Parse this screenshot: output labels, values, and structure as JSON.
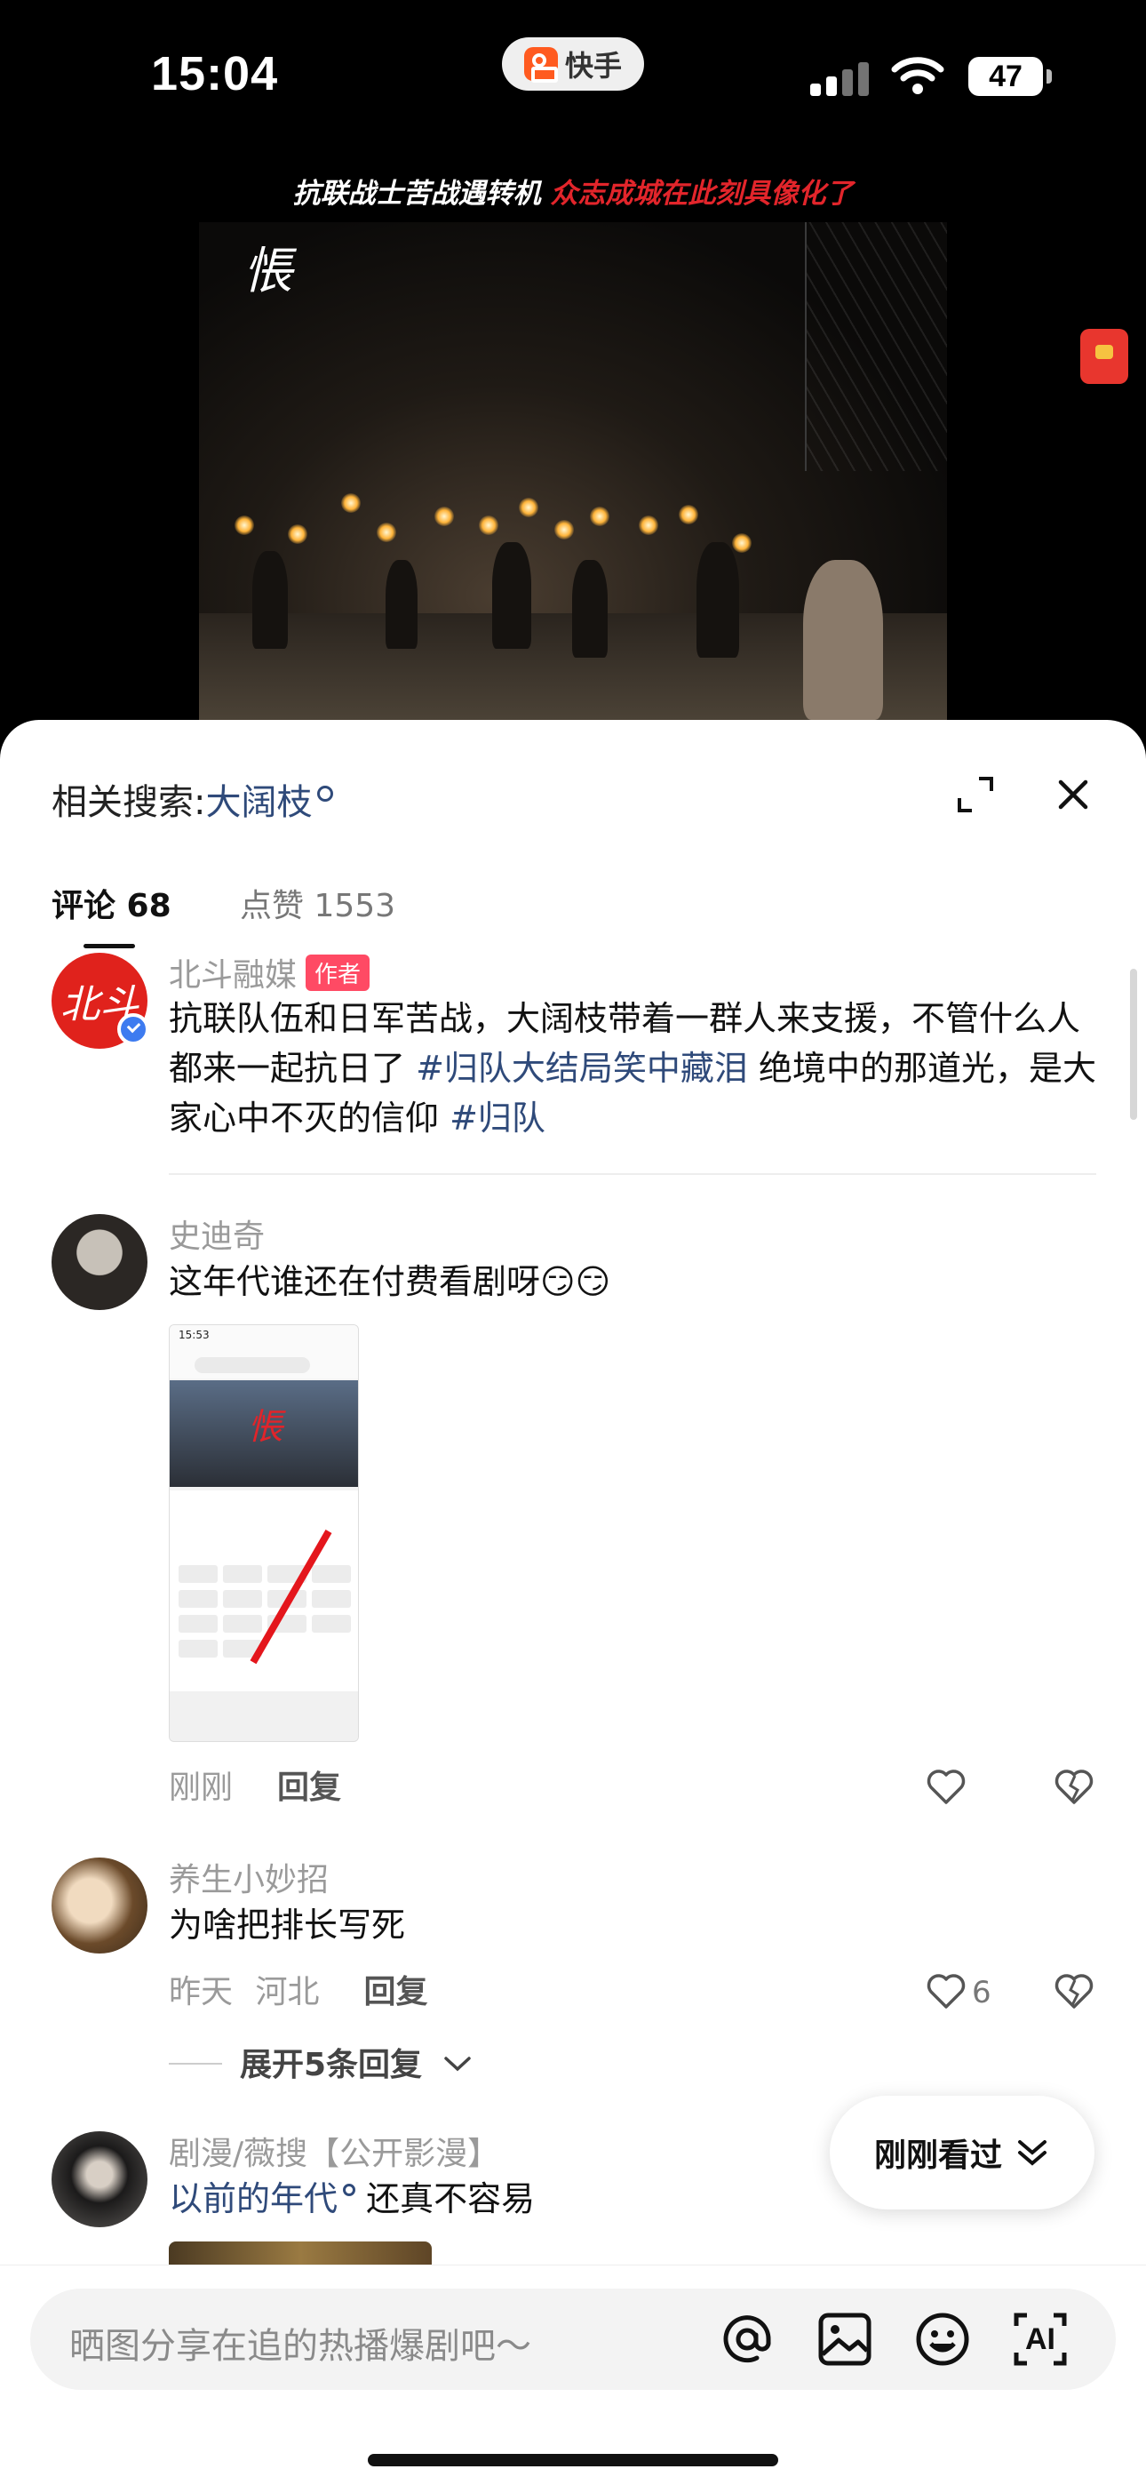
{
  "status_bar": {
    "time": "15:04",
    "app_name": "快手",
    "battery": "47"
  },
  "video": {
    "caption_part1": "抗联战士苦战遇转机",
    "caption_part2": "众志成城在此刻具像化了",
    "logo": "悵"
  },
  "sheet": {
    "related_label": "相关搜索:",
    "related_term": "大阔枝",
    "tabs": {
      "comments": "评论 68",
      "likes": "点赞 1553"
    }
  },
  "comments": [
    {
      "avatar_text": "北斗",
      "user": "北斗融媒",
      "badge": "作者",
      "text_part1": "抗联队伍和日军苦战，大阔枝带着一群人来支援，不管什么人都来一起抗日了 ",
      "tag1": "#归队大结局笑中藏泪",
      "text_part2": " 绝境中的那道光，是大家心中不灭的信仰 ",
      "tag2": "#归队"
    },
    {
      "user": "史迪奇",
      "text": "这年代谁还在付费看剧呀😏😏",
      "thumb_time": "15:53",
      "thumb_logo": "悵",
      "time": "刚刚",
      "reply": "回复"
    },
    {
      "user": "养生小妙招",
      "text": "为啥把排长写死",
      "time": "昨天",
      "location": "河北",
      "reply": "回复",
      "likes": "6",
      "expand": "展开5条回复"
    },
    {
      "user": "剧漫/薇搜【公开影漫】",
      "tag": "以前的年代",
      "text": " 还真不容易"
    }
  ],
  "recently_seen": "刚刚看过",
  "input": {
    "placeholder": "晒图分享在追的热播爆剧吧～",
    "ai_label": "AI"
  },
  "colors": {
    "link": "#2f4a7a",
    "badge": "#ff4a64",
    "caption_red": "#e2252b"
  }
}
